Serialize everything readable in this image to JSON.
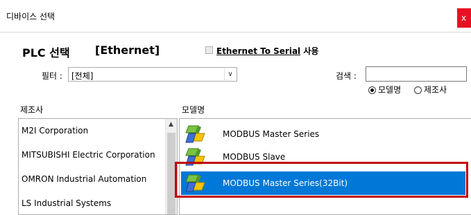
{
  "window": {
    "title": "디바이스 선택",
    "close_label": "x"
  },
  "header": {
    "plc_label": "PLC 선택",
    "connection_label": "[Ethernet]",
    "ets_link": "Ethernet To Serial",
    "ets_suffix": " 사용",
    "ets_checked": false
  },
  "filter": {
    "label": "필터 :",
    "value": "[전체]",
    "dropdown_icon": "chevron-down-icon"
  },
  "search": {
    "label": "검색 :",
    "value": ""
  },
  "search_mode": {
    "options": [
      {
        "label": "모델명",
        "selected": true
      },
      {
        "label": "제조사",
        "selected": false
      }
    ]
  },
  "manufacturers": {
    "header": "제조사",
    "items": [
      "M2I Corporation",
      "MITSUBISHI Electric Corporation",
      "OMRON Industrial Automation",
      "LS Industrial Systems"
    ]
  },
  "models": {
    "header": "모델명",
    "items": [
      {
        "label": "MODBUS Master Series",
        "selected": false
      },
      {
        "label": "MODBUS Slave",
        "selected": false
      },
      {
        "label": "MODBUS Master Series(32Bit)",
        "selected": true
      }
    ]
  },
  "colors": {
    "selection": "#0078d7",
    "highlight_border": "#c00000",
    "close": "#e81123"
  }
}
